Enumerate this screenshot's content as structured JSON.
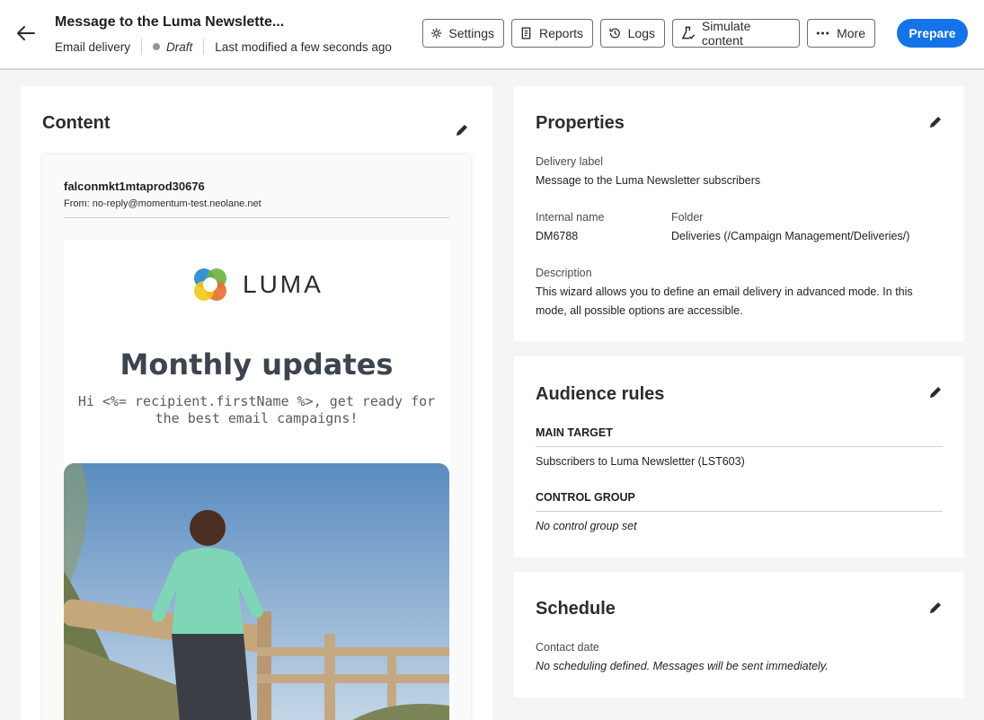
{
  "header": {
    "title": "Message to the Luma Newslette...",
    "type": "Email delivery",
    "status": "Draft",
    "modified": "Last modified a few seconds ago",
    "buttons": {
      "settings": "Settings",
      "reports": "Reports",
      "logs": "Logs",
      "simulate": "Simulate content",
      "more": "More",
      "prepare": "Prepare"
    }
  },
  "content": {
    "title": "Content",
    "sender": "falconmkt1mtaprod30676",
    "from": "From: no-reply@momentum-test.neolane.net",
    "brand": "LUMA",
    "headline": "Monthly updates",
    "greeting": "Hi <%= recipient.firstName %>, get ready for the best email campaigns!"
  },
  "properties": {
    "title": "Properties",
    "delivery_label_lbl": "Delivery label",
    "delivery_label": "Message to the Luma Newsletter subscribers",
    "internal_name_lbl": "Internal name",
    "internal_name": "DM6788",
    "folder_lbl": "Folder",
    "folder": "Deliveries (/Campaign Management/Deliveries/)",
    "description_lbl": "Description",
    "description": "This wizard allows you to define an email delivery in advanced mode. In this mode, all possible options are accessible."
  },
  "audience": {
    "title": "Audience rules",
    "main_target_lbl": "MAIN TARGET",
    "main_target": "Subscribers to Luma Newsletter (LST603)",
    "control_group_lbl": "CONTROL GROUP",
    "control_group": "No control group set"
  },
  "schedule": {
    "title": "Schedule",
    "contact_date_lbl": "Contact date",
    "contact_date": "No scheduling defined. Messages will be sent immediately."
  },
  "colors": {
    "accent": "#1473e6",
    "draft_dot": "#959595"
  }
}
